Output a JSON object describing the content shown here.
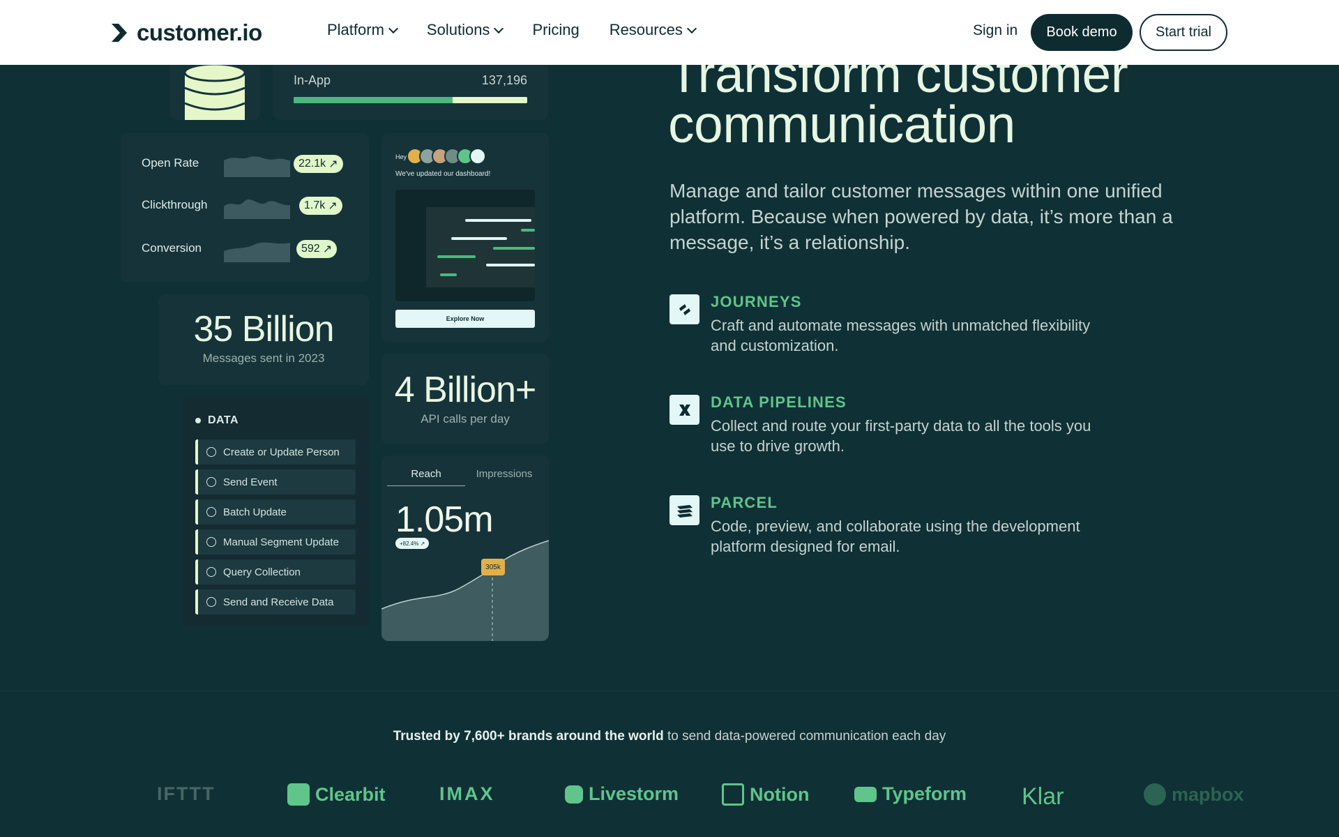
{
  "nav": {
    "logo_text": "customer.io",
    "menu": [
      {
        "label": "Platform",
        "has_chevron": true
      },
      {
        "label": "Solutions",
        "has_chevron": true
      },
      {
        "label": "Pricing",
        "has_chevron": false
      },
      {
        "label": "Resources",
        "has_chevron": true
      }
    ],
    "sign_in": "Sign in",
    "book_demo": "Book demo",
    "start_trial": "Start trial"
  },
  "collage": {
    "inapp": {
      "label": "In-App",
      "value": "137,196",
      "progress_pct": 68
    },
    "metrics": [
      {
        "name": "Open Rate",
        "value": "22.1k"
      },
      {
        "name": "Clickthrough",
        "value": "1.7k"
      },
      {
        "name": "Conversion",
        "value": "592"
      }
    ],
    "notification": {
      "hey": "Hey",
      "text": "We've updated our dashboard!",
      "button": "Explore Now"
    },
    "messages_stat": {
      "value": "35 Billion",
      "label": "Messages sent in 2023"
    },
    "api_stat": {
      "value": "4 Billion+",
      "label": "API calls per day"
    },
    "data_panel": {
      "title": "DATA",
      "items": [
        "Create or Update Person",
        "Send Event",
        "Batch Update",
        "Manual Segment Update",
        "Query Collection",
        "Send and Receive Data"
      ]
    },
    "reach": {
      "tabs": [
        "Reach",
        "Impressions"
      ],
      "value": "1.05m",
      "delta": "+82.4% ↗",
      "tooltip": "305k"
    }
  },
  "hero": {
    "headline": "Transform customer communication",
    "subcopy": "Manage and tailor customer messages within one unified platform. Because when powered by data, it’s more than a message, it’s a relationship."
  },
  "features": [
    {
      "title": "JOURNEYS",
      "desc": "Craft and automate messages with unmatched flexibility and customization.",
      "icon": "journeys-icon"
    },
    {
      "title": "DATA PIPELINES",
      "desc": "Collect and route your first-party data to all the tools you use to drive growth.",
      "icon": "pipelines-icon"
    },
    {
      "title": "PARCEL",
      "desc": "Code, preview, and collaborate using the development platform designed for email.",
      "icon": "parcel-icon"
    }
  ],
  "trust": {
    "bold": "Trusted by 7,600+ brands around the world",
    "rest": "to send data-powered communication each day"
  },
  "brands": [
    "IFTTT",
    "Clearbit",
    "IMAX",
    "Livestorm",
    "Notion",
    "Typeform",
    "Klar",
    "mapbox"
  ],
  "colors": {
    "accent": "#5fc58a",
    "bg": "#0f3035",
    "nav_dark": "#0e2b30",
    "lime": "#e5f7c8"
  }
}
